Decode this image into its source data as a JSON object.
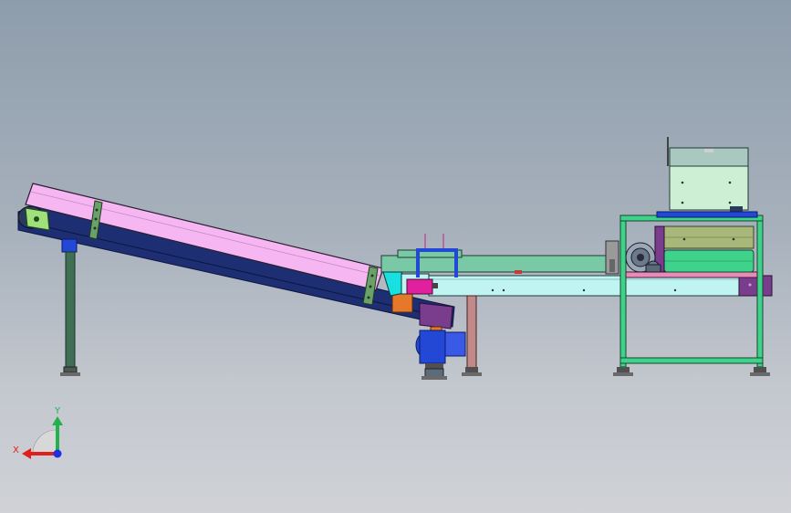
{
  "viewport": {
    "background_top": "#8e9dac",
    "background_bottom": "#d0d2d7"
  },
  "triad": {
    "x_label": "X",
    "y_label": "Y",
    "x_color": "#e0201c",
    "y_color": "#22b14c",
    "z_color": "#1f2ee0"
  },
  "model": {
    "colors": {
      "incline_cover": "#f6b6f2",
      "incline_frame": "#1d2e72",
      "support_leg": "#3f6f54",
      "feeder_body": "#79c9a7",
      "feeder_bed": "#bff4f2",
      "machine_frame": "#3ed28a",
      "motor_blue": "#2348d6",
      "drive_purple": "#7a3c8c",
      "accent_magenta": "#e0209e",
      "accent_orange": "#e6782a"
    }
  }
}
